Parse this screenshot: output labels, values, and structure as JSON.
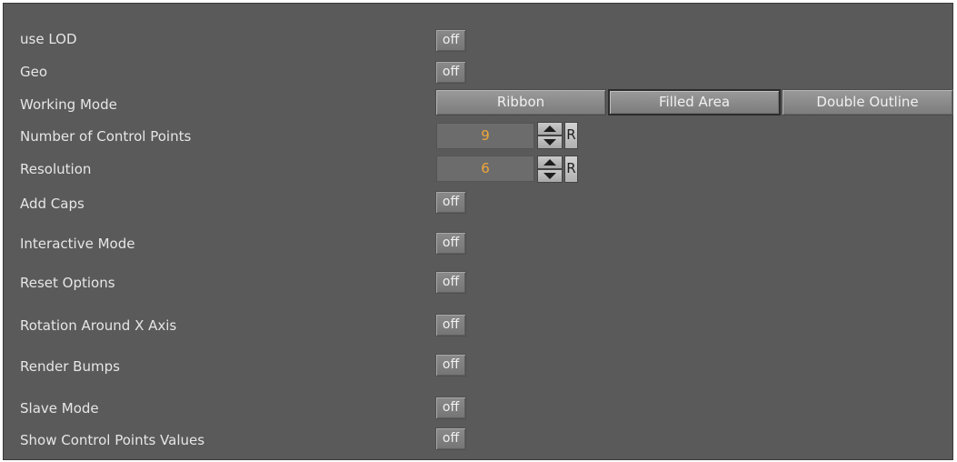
{
  "rows": {
    "use_lod": {
      "label": "use LOD",
      "value": "off"
    },
    "geo": {
      "label": "Geo",
      "value": "off"
    },
    "working_mode": {
      "label": "Working Mode",
      "options": [
        "Ribbon",
        "Filled Area",
        "Double Outline"
      ],
      "selected": "Filled Area"
    },
    "control_points": {
      "label": "Number of Control Points",
      "value": "9",
      "reset_label": "R"
    },
    "resolution": {
      "label": "Resolution",
      "value": "6",
      "reset_label": "R"
    },
    "add_caps": {
      "label": "Add Caps",
      "value": "off"
    },
    "interactive_mode": {
      "label": "Interactive Mode",
      "value": "off"
    },
    "reset_options": {
      "label": "Reset Options",
      "value": "off"
    },
    "rotation_x": {
      "label": "Rotation Around X Axis",
      "value": "off"
    },
    "render_bumps": {
      "label": "Render Bumps",
      "value": "off"
    },
    "slave_mode": {
      "label": "Slave Mode",
      "value": "off"
    },
    "show_cp_values": {
      "label": "Show Control Points Values",
      "value": "off"
    }
  },
  "colors": {
    "panel_bg": "#5a5a5a",
    "label_text": "#e6e6e6",
    "numeric_value": "#f0a63a"
  },
  "icons": {
    "spinner_up": "arrow-up-icon",
    "spinner_down": "arrow-down-icon"
  }
}
